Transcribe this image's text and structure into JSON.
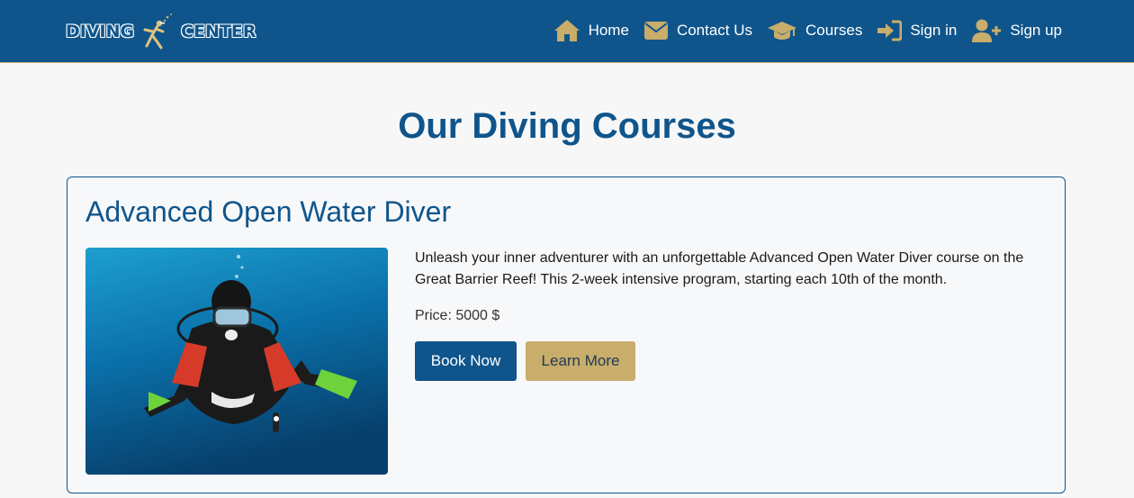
{
  "brand": {
    "part1": "DIVING",
    "part2": "CENTER"
  },
  "nav": [
    {
      "label": "Home",
      "icon": "home-icon"
    },
    {
      "label": "Contact Us",
      "icon": "envelope-icon"
    },
    {
      "label": "Courses",
      "icon": "graduation-cap-icon"
    },
    {
      "label": "Sign in",
      "icon": "sign-in-icon"
    },
    {
      "label": "Sign up",
      "icon": "user-plus-icon"
    }
  ],
  "page": {
    "title": "Our Diving Courses"
  },
  "courses": [
    {
      "title": "Advanced Open Water Diver",
      "image_alt": "scuba diver underwater",
      "description": "Unleash your inner adventurer with an unforgettable Advanced Open Water Diver course on the Great Barrier Reef! This 2-week intensive program, starting each 10th of the month.",
      "price": "Price: 5000 $",
      "book_label": "Book Now",
      "learn_label": "Learn More"
    }
  ],
  "colors": {
    "primary": "#0f558b",
    "accent": "#c8ad6b",
    "background": "#f7f7f7"
  }
}
